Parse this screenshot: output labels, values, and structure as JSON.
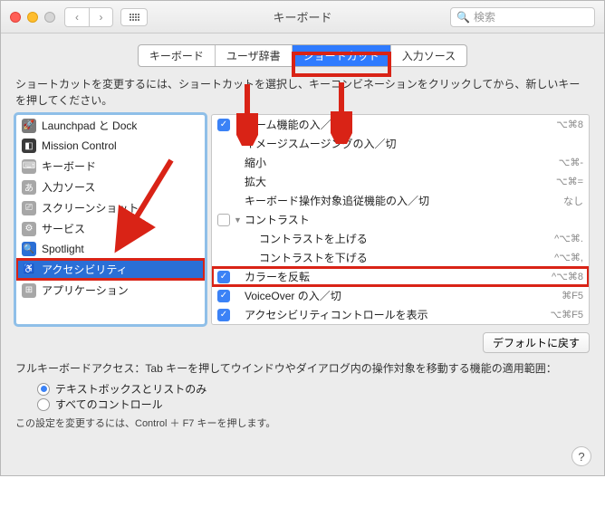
{
  "window": {
    "title": "キーボード"
  },
  "search": {
    "placeholder": "検索"
  },
  "tabs": [
    {
      "label": "キーボード",
      "selected": false
    },
    {
      "label": "ユーザ辞書",
      "selected": false
    },
    {
      "label": "ショートカット",
      "selected": true
    },
    {
      "label": "入力ソース",
      "selected": false
    }
  ],
  "hint": "ショートカットを変更するには、ショートカットを選択し、キーコンビネーションをクリックしてから、新しいキーを押してください。",
  "categories": [
    {
      "icon": "rocket",
      "color": "#7a7a7a",
      "label": "Launchpad と Dock"
    },
    {
      "icon": "mc",
      "color": "#3a3a3a",
      "label": "Mission Control"
    },
    {
      "icon": "kb",
      "color": "#a7a7a7",
      "label": "キーボード"
    },
    {
      "icon": "input",
      "color": "#a7a7a7",
      "label": "入力ソース"
    },
    {
      "icon": "camera",
      "color": "#a7a7a7",
      "label": "スクリーンショット"
    },
    {
      "icon": "gear",
      "color": "#a7a7a7",
      "label": "サービス"
    },
    {
      "icon": "spot",
      "color": "#2a6fd6",
      "label": "Spotlight"
    },
    {
      "icon": "access",
      "color": "#2a6fd6",
      "label": "アクセシビリティ",
      "selected": true,
      "highlight": true
    },
    {
      "icon": "app",
      "color": "#a7a7a7",
      "label": "アプリケーション"
    }
  ],
  "shortcuts": [
    {
      "checked": true,
      "indent": 0,
      "label": "ズーム機能の入／切",
      "sc": "⌥⌘8"
    },
    {
      "checked": null,
      "indent": 0,
      "label": "イメージスムージングの入／切",
      "sc": ""
    },
    {
      "checked": null,
      "indent": 0,
      "label": "縮小",
      "sc": "⌥⌘-"
    },
    {
      "checked": null,
      "indent": 0,
      "label": "拡大",
      "sc": "⌥⌘="
    },
    {
      "checked": null,
      "indent": 0,
      "label": "キーボード操作対象追従機能の入／切",
      "sc": "なし"
    },
    {
      "checked": false,
      "indent": 0,
      "label": "コントラスト",
      "sc": "",
      "expand": true
    },
    {
      "checked": null,
      "indent": 1,
      "label": "コントラストを上げる",
      "sc": "^⌥⌘."
    },
    {
      "checked": null,
      "indent": 1,
      "label": "コントラストを下げる",
      "sc": "^⌥⌘,"
    },
    {
      "checked": true,
      "indent": 0,
      "label": "カラーを反転",
      "sc": "^⌥⌘8",
      "highlight": true
    },
    {
      "checked": true,
      "indent": 0,
      "label": "VoiceOver の入／切",
      "sc": "⌘F5"
    },
    {
      "checked": true,
      "indent": 0,
      "label": "アクセシビリティコントロールを表示",
      "sc": "⌥⌘F5"
    }
  ],
  "defaults_button": "デフォルトに戻す",
  "fullaccess": {
    "text": "フルキーボードアクセス：Tab キーを押してウインドウやダイアログ内の操作対象を移動する機能の適用範囲：",
    "options": [
      {
        "label": "テキストボックスとリストのみ",
        "selected": true
      },
      {
        "label": "すべてのコントロール",
        "selected": false
      }
    ],
    "note": "この設定を変更するには、Control ＋ F7 キーを押します。"
  }
}
